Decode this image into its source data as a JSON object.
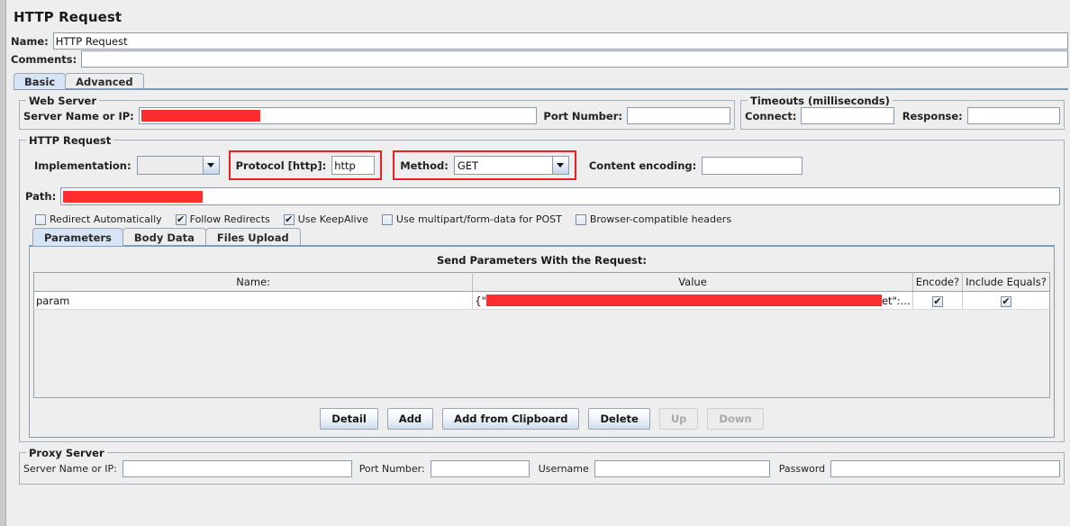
{
  "window": {
    "title": "HTTP Request"
  },
  "name_row": {
    "label": "Name:",
    "value": "HTTP Request"
  },
  "comments_row": {
    "label": "Comments:",
    "value": ""
  },
  "tabs": [
    {
      "label": "Basic",
      "selected": true
    },
    {
      "label": "Advanced",
      "selected": false
    }
  ],
  "web_server": {
    "group_title": "Web Server",
    "server_label": "Server Name or IP:",
    "server_value": "",
    "server_redacted": true,
    "port_label": "Port Number:",
    "port_value": ""
  },
  "timeouts": {
    "group_title": "Timeouts (milliseconds)",
    "connect_label": "Connect:",
    "connect_value": "",
    "response_label": "Response:",
    "response_value": ""
  },
  "http_request": {
    "group_title": "HTTP Request",
    "implementation_label": "Implementation:",
    "implementation_value": "",
    "protocol_label": "Protocol [http]:",
    "protocol_value": "http",
    "method_label": "Method:",
    "method_value": "GET",
    "content_encoding_label": "Content encoding:",
    "content_encoding_value": "",
    "path_label": "Path:",
    "path_value": "",
    "path_redacted": true
  },
  "checkboxes": [
    {
      "label": "Redirect Automatically",
      "checked": false
    },
    {
      "label": "Follow Redirects",
      "checked": true
    },
    {
      "label": "Use KeepAlive",
      "checked": true
    },
    {
      "label": "Use multipart/form-data for POST",
      "checked": false
    },
    {
      "label": "Browser-compatible headers",
      "checked": false
    }
  ],
  "inner_tabs": [
    {
      "label": "Parameters",
      "selected": true
    },
    {
      "label": "Body Data",
      "selected": false
    },
    {
      "label": "Files Upload",
      "selected": false
    }
  ],
  "parameters": {
    "header": "Send Parameters With the Request:",
    "columns": [
      "Name:",
      "Value",
      "Encode?",
      "Include Equals?"
    ],
    "rows": [
      {
        "name": "param",
        "value_prefix": "{\"",
        "value_suffix": "et\":...",
        "value_redacted": true,
        "encode": true,
        "include_equals": true
      }
    ]
  },
  "param_buttons": [
    {
      "label": "Detail",
      "enabled": true
    },
    {
      "label": "Add",
      "enabled": true
    },
    {
      "label": "Add from Clipboard",
      "enabled": true
    },
    {
      "label": "Delete",
      "enabled": true
    },
    {
      "label": "Up",
      "enabled": false
    },
    {
      "label": "Down",
      "enabled": false
    }
  ],
  "proxy_server": {
    "group_title": "Proxy Server",
    "server_label": "Server Name or IP:",
    "server_value": "",
    "port_label": "Port Number:",
    "port_value": "",
    "username_label": "Username",
    "username_value": "",
    "password_label": "Password",
    "password_value": ""
  },
  "colors": {
    "panel": "#eeeeee",
    "field": "#ffffff",
    "tab_selected": "#d6e4f5",
    "annotation_red": "#e8201e",
    "redaction_red": "#fb2d2d",
    "border": "#8c9aa8"
  }
}
